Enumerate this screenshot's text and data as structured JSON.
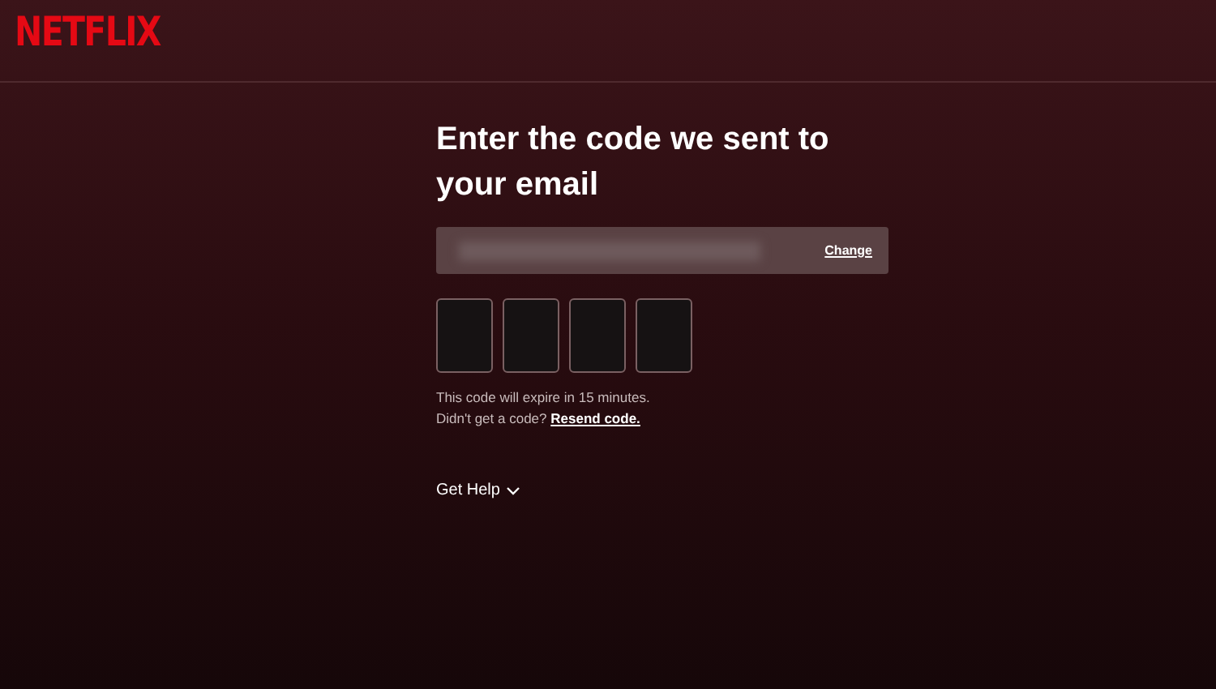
{
  "logo": "NETFLIX",
  "heading": "Enter the code we sent to your email",
  "email_field": {
    "action": "Change"
  },
  "code_boxes": [
    {
      "kind": "digit"
    },
    {
      "kind": "digit"
    },
    {
      "kind": "digit"
    },
    {
      "kind": "digit"
    }
  ],
  "expiry_note": "This code will expire in 15 minutes.",
  "resend": {
    "prompt": "Didn't get a code?",
    "link": "Resend code."
  },
  "help": {
    "label": "Get Help"
  }
}
